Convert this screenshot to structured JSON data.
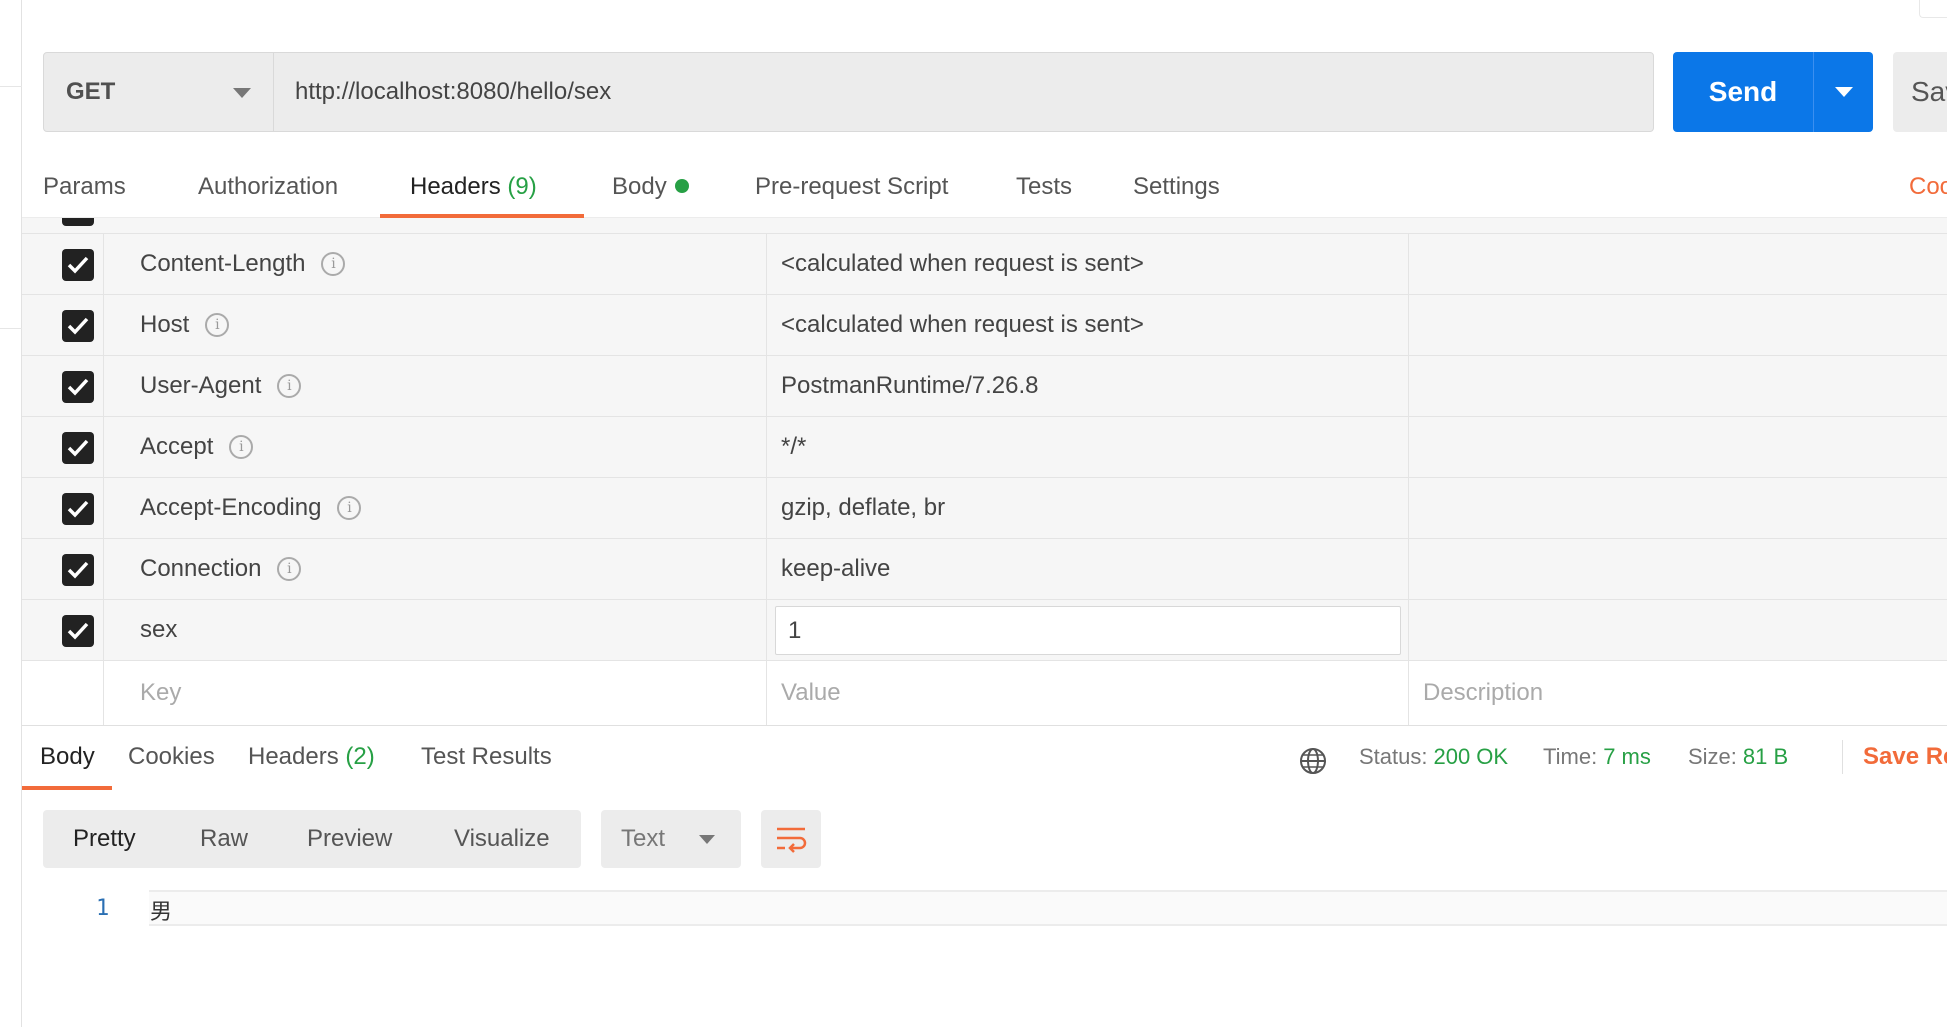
{
  "request": {
    "method": "GET",
    "url": "http://localhost:8080/hello/sex",
    "send_label": "Send",
    "save_label": "Sav"
  },
  "request_tabs": {
    "params": "Params",
    "authorization": "Authorization",
    "headers": "Headers",
    "headers_count": "(9)",
    "body": "Body",
    "pre_request": "Pre-request Script",
    "tests": "Tests",
    "settings": "Settings",
    "cookies": "Cooki"
  },
  "headers": [
    {
      "key": "Content-Length",
      "value": "<calculated when request is sent>",
      "checked": true
    },
    {
      "key": "Host",
      "value": "<calculated when request is sent>",
      "checked": true
    },
    {
      "key": "User-Agent",
      "value": "PostmanRuntime/7.26.8",
      "checked": true
    },
    {
      "key": "Accept",
      "value": "*/*",
      "checked": true
    },
    {
      "key": "Accept-Encoding",
      "value": "gzip, deflate, br",
      "checked": true
    },
    {
      "key": "Connection",
      "value": "keep-alive",
      "checked": true
    },
    {
      "key": "sex",
      "value": "1",
      "checked": true
    }
  ],
  "new_header": {
    "key_placeholder": "Key",
    "value_placeholder": "Value",
    "description_placeholder": "Description"
  },
  "response": {
    "tabs": {
      "body": "Body",
      "cookies": "Cookies",
      "headers": "Headers",
      "headers_count": "(2)",
      "test_results": "Test Results"
    },
    "status_label": "Status:",
    "status_value": "200 OK",
    "time_label": "Time:",
    "time_value": "7 ms",
    "size_label": "Size:",
    "size_value": "81 B",
    "save_label": "Save Resp",
    "views": {
      "pretty": "Pretty",
      "raw": "Raw",
      "preview": "Preview",
      "visualize": "Visualize"
    },
    "format": "Text",
    "body_lines": [
      {
        "number": "1",
        "text": "男"
      }
    ]
  },
  "colors": {
    "accent": "#f26b3a",
    "primary": "#0b77e8",
    "success": "#27a045"
  }
}
